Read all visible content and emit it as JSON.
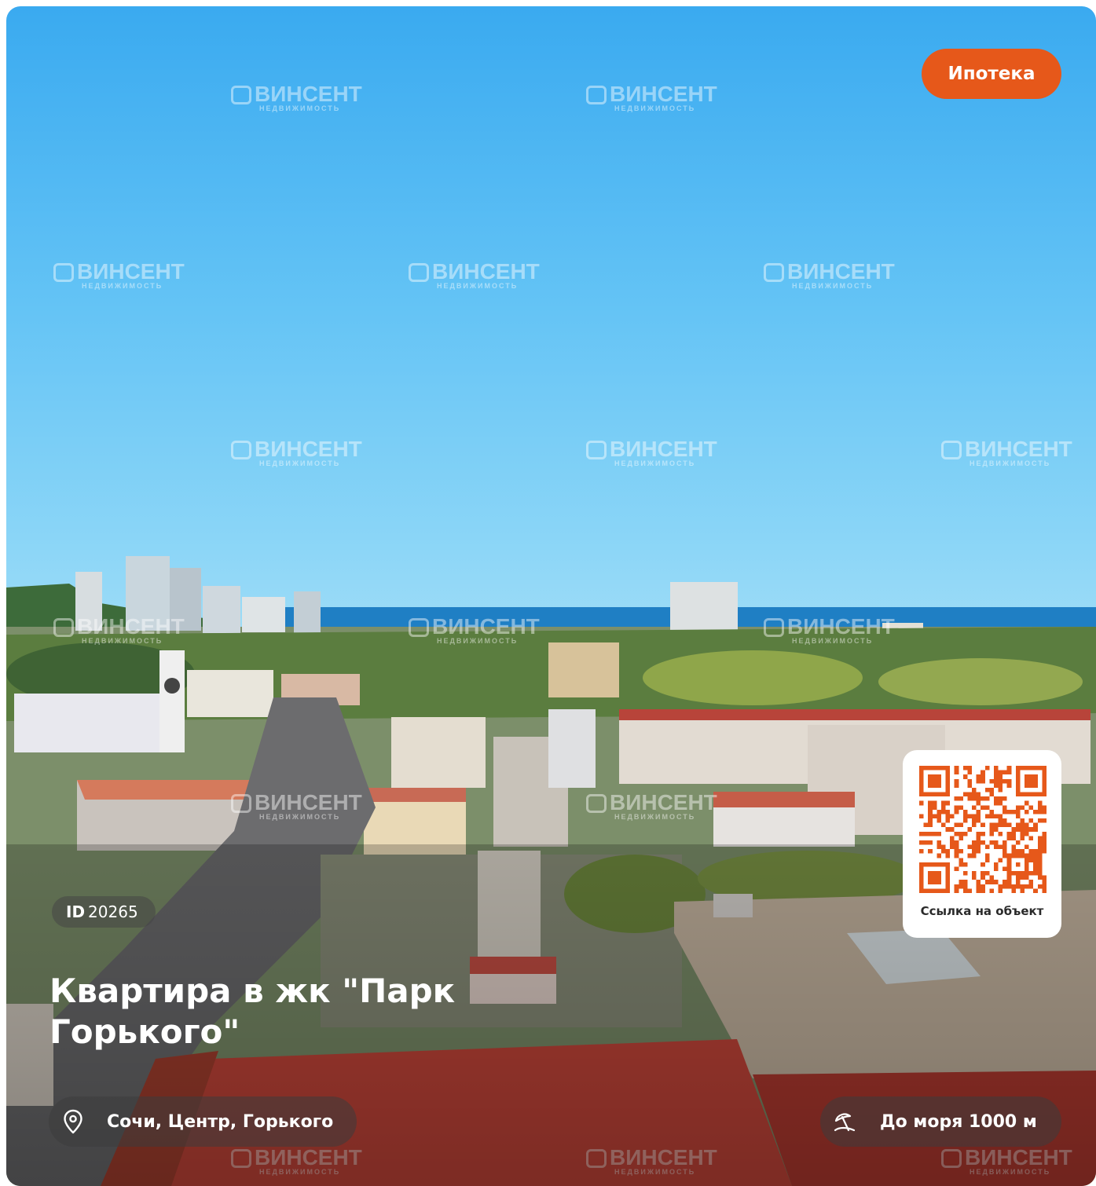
{
  "listing": {
    "mortgage_label": "Ипотека",
    "id_prefix": "ID",
    "id_value": "20265",
    "title": "Квартира в жк \"Парк Горького\"",
    "address": "Сочи, Центр, Горького",
    "sea_distance": "До моря 1000 м",
    "qr_caption": "Ссылка на объект"
  },
  "watermark": {
    "brand": "ВИНСЕНТ",
    "sub": "НЕДВИЖИМОСТЬ"
  },
  "colors": {
    "accent": "#e6581a",
    "qr": "#e6581a"
  },
  "icons": {
    "location": "map-pin-icon",
    "beach": "beach-umbrella-icon"
  }
}
